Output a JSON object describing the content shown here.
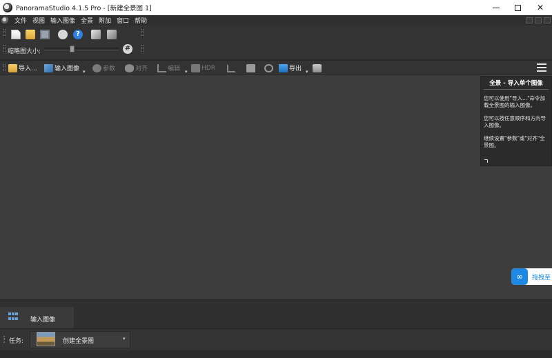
{
  "window": {
    "title": "PanoramaStudio 4.1.5 Pro - [新建全景图 1]",
    "minimize": "—",
    "maximize": "☐",
    "close": "✕"
  },
  "menu": [
    "文件",
    "视图",
    "输入图像",
    "全景",
    "附加",
    "窗口",
    "帮助"
  ],
  "toolbar1": {
    "icons": [
      "new-document-icon",
      "open-folder-icon",
      "save-icon",
      "info-icon",
      "help-icon",
      "panorama-icon",
      "panorama-export-icon"
    ],
    "help_glyph": "?",
    "thumb_size_label": "缩略图大小:",
    "thumb_size_level": 0.37,
    "grid_glyph": "#"
  },
  "toolbar2": {
    "import_label": "导入...",
    "input_images_label": "输入图像",
    "params_label": "参数",
    "align_label": "对齐",
    "edit_label": "编辑",
    "hdr_label": "HDR",
    "export_label": "导出",
    "dropdown_glyph": "▾"
  },
  "help_panel": {
    "title": "全景 - 导入单个图像",
    "paragraphs": [
      "您可以使用\"导入...\"命令加载全景图的输入图像。",
      "您可以按任意顺序和方向导入图像。",
      "继续设置\"参数\"或\"对齐\"全景图。"
    ]
  },
  "drag_button": {
    "label": "拖拽至"
  },
  "tabs": [
    {
      "label": "输入图像",
      "active": true
    }
  ],
  "task": {
    "label": "任务:",
    "value": "创建全景图",
    "caret": "▾"
  },
  "colors": {
    "accent": "#1e88e5",
    "background": "#3b3b3b",
    "panel": "#2b2b2b"
  }
}
